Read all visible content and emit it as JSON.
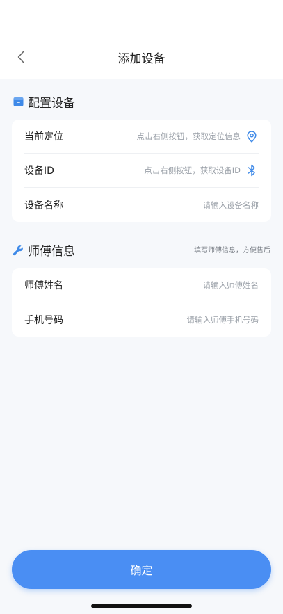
{
  "header": {
    "title": "添加设备"
  },
  "config_section": {
    "title": "配置设备",
    "icon": "box-icon",
    "rows": [
      {
        "label": "当前定位",
        "hint": "点击右侧按钮，获取定位信息",
        "icon": "location-pin-icon"
      },
      {
        "label": "设备ID",
        "hint": "点击右侧按钮，获取设备ID",
        "icon": "bluetooth-icon"
      },
      {
        "label": "设备名称",
        "placeholder": "请输入设备名称"
      }
    ]
  },
  "master_section": {
    "title": "师傅信息",
    "hint": "填写师傅信息，方便售后",
    "icon": "wrench-icon",
    "rows": [
      {
        "label": "师傅姓名",
        "placeholder": "请输入师傅姓名"
      },
      {
        "label": "手机号码",
        "placeholder": "请输入师傅手机号码"
      }
    ]
  },
  "footer": {
    "confirm_label": "确定"
  },
  "colors": {
    "accent": "#4a8ef3",
    "background": "#f6f8fb",
    "icon_blue": "#3f8ae8"
  }
}
